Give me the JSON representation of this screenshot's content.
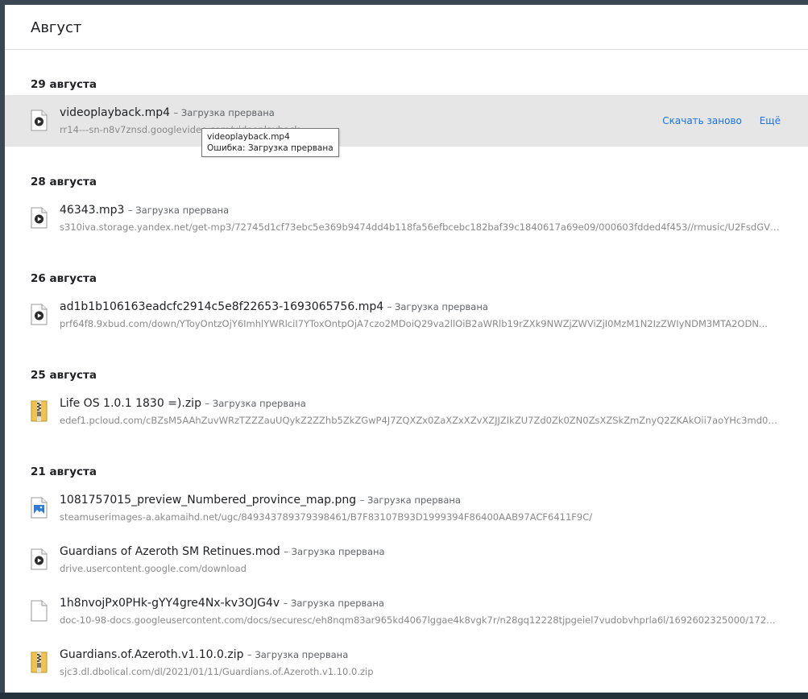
{
  "month": "Август",
  "groups": [
    {
      "date": "29 августа",
      "items": [
        {
          "icon": "video-file-icon",
          "name": "videoplayback.mp4",
          "status": "– Загрузка прервана",
          "url": "rr14---sn-n8v7znsd.googlevideo.com/videoplayback",
          "retry": "Скачать заново",
          "more": "Ещё"
        }
      ]
    },
    {
      "date": "28 августа",
      "items": [
        {
          "icon": "video-file-icon",
          "name": "46343.mp3",
          "status": "– Загрузка прервана",
          "url": "s310iva.storage.yandex.net/get-mp3/72745d1cf73ebc5e369b9474dd4b118fa56efbcebc182baf39c1840617a69e09/000603fdded4f453//rmusic/U2FsdGVkX..."
        }
      ]
    },
    {
      "date": "26 августа",
      "items": [
        {
          "icon": "video-file-icon",
          "name": "ad1b1b106163eadcfc2914c5e8f22653-1693065756.mp4",
          "status": "– Загрузка прервана",
          "url": "prf64f8.9xbud.com/down/YToyOntzOjY6ImhlYWRlciI7YToxOntpOjA7czo2MDoiQ29va2llOiB2aWRlb19rZXk9NWZjZWViZjI0MzM1N2IzZWIyNDM3MTA2ODN..."
        }
      ]
    },
    {
      "date": "25 августа",
      "items": [
        {
          "icon": "zip-file-icon",
          "name": "Life OS 1.0.1 1830 =).zip",
          "status": "– Загрузка прервана",
          "url": "edef1.pcloud.com/cBZsM5AAhZuvWRzTZZZauUQykZ2ZZhb5ZkZGwP4J7ZQXZx0ZaXZxXZvXZJJZIkZU7Zd0Zk0ZN0ZsXZSkZmZnyQ2ZKAkOii7aoYHc3md0zt0..."
        }
      ]
    },
    {
      "date": "21 августа",
      "items": [
        {
          "icon": "image-file-icon",
          "name": "1081757015_preview_Numbered_province_map.png",
          "status": "– Загрузка прервана",
          "url": "steamuserimages-a.akamaihd.net/ugc/849343789379398461/B7F83107B93D1999394F86400AAB97ACF6411F9C/"
        },
        {
          "icon": "video-file-icon",
          "name": "Guardians of Azeroth SM Retinues.mod",
          "status": "– Загрузка прервана",
          "url": "drive.usercontent.google.com/download"
        },
        {
          "icon": "blank-file-icon",
          "name": "1h8nvojPx0PHk-gYY4gre4Nx-kv3OJG4v",
          "status": "– Загрузка прервана",
          "url": "doc-10-98-docs.googleusercontent.com/docs/securesc/eh8nqm83ar965kd4067lggae4k8vgk7r/n28gq12228tjpgeiel7vudobvhprla6l/1692602325000/1729..."
        },
        {
          "icon": "zip-file-icon",
          "name": "Guardians.of.Azeroth.v1.10.0.zip",
          "status": "– Загрузка прервана",
          "url": "sjc3.dl.dbolical.com/dl/2021/01/11/Guardians.of.Azeroth.v1.10.0.zip"
        }
      ]
    }
  ],
  "tooltip": {
    "line1": "videoplayback.mp4",
    "line2": "Ошибка: Загрузка прервана"
  },
  "colors": {
    "link": "#1a73e8",
    "highlight": "#e6e6e6",
    "background": "#3a4652"
  }
}
